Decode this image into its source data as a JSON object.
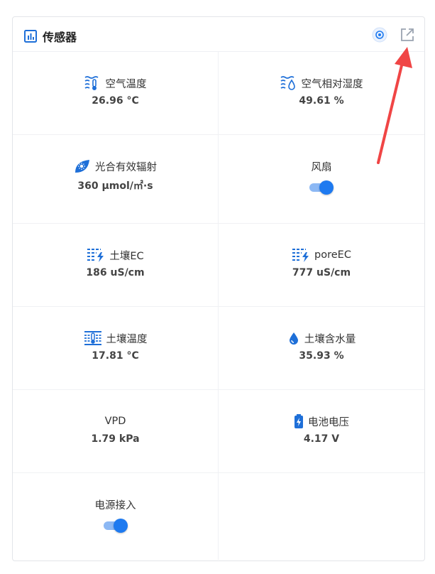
{
  "card": {
    "title": "传感器",
    "title_icon": "bar-chart-icon",
    "actions": [
      {
        "name": "focus-button",
        "icon": "target-icon"
      },
      {
        "name": "open-external-button",
        "icon": "external-link-icon"
      }
    ]
  },
  "sensors": [
    {
      "label": "空气温度",
      "value": "26.96 °C",
      "icon": "air-temperature-icon"
    },
    {
      "label": "空气相对湿度",
      "value": "49.61 %",
      "icon": "air-humidity-icon"
    },
    {
      "label": "光合有效辐射",
      "value": "360 μmol/㎡·s",
      "icon": "par-leaf-icon"
    },
    {
      "label": "风扇",
      "toggle": true,
      "icon": ""
    },
    {
      "label": "土壤EC",
      "value": "186 uS/cm",
      "icon": "soil-ec-icon"
    },
    {
      "label": "poreEC",
      "value": "777 uS/cm",
      "icon": "pore-ec-icon"
    },
    {
      "label": "土壤温度",
      "value": "17.81 °C",
      "icon": "soil-temperature-icon"
    },
    {
      "label": "土壤含水量",
      "value": "35.93 %",
      "icon": "water-drop-icon"
    },
    {
      "label": "VPD",
      "value": "1.79 kPa",
      "icon": ""
    },
    {
      "label": "电池电压",
      "value": "4.17 V",
      "icon": "battery-icon"
    },
    {
      "label": "电源接入",
      "toggle": true,
      "icon": ""
    }
  ],
  "colors": {
    "accent": "#1e7af0",
    "toggle_track": "#8cb8f4",
    "annotation_arrow": "#f04545",
    "border": "#e3e5e9"
  }
}
